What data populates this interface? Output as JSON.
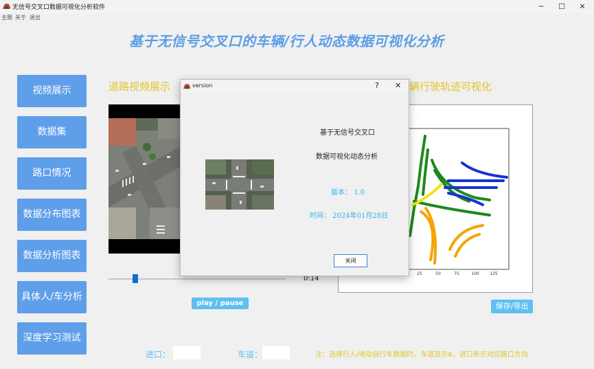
{
  "window": {
    "title": "无信号交叉口数据可视化分析软件"
  },
  "menu": [
    "主题",
    "关于",
    "退出"
  ],
  "main_title": "基于无信号交叉口的车辆/行人动态数据可视化分析",
  "nav": [
    "视频展示",
    "数据集",
    "路口情况",
    "数据分布图表",
    "数据分析图表",
    "具体人/车分析",
    "深度学习测试"
  ],
  "sections": {
    "left": "道路视频展示",
    "right": "辆行驶轨迹可视化"
  },
  "video": {
    "time": "0:14",
    "progress": 0.15,
    "play_label": "play / pause"
  },
  "chart": {
    "save_label": "保存/导出"
  },
  "chart_data": {
    "type": "line",
    "x_ticks": [
      "25",
      "50",
      "75",
      "100",
      "125"
    ],
    "series_colors": [
      "#1a8a1a",
      "#1433d6",
      "#f5a400",
      "#f2e210"
    ]
  },
  "bottom": {
    "entry_label": "进口：",
    "lane_label": "车道：",
    "note": "注：选择行人/电动自行车数据时，车道显示6，进口表示对应路口方向"
  },
  "dialog": {
    "title": "version",
    "help": "?",
    "close_x": "✕",
    "line1": "基于无信号交叉口",
    "line2": "数据可视化动态分析",
    "version": "版本：  1.0",
    "date": "时间：  2024年01月28日",
    "close_label": "关闭"
  }
}
